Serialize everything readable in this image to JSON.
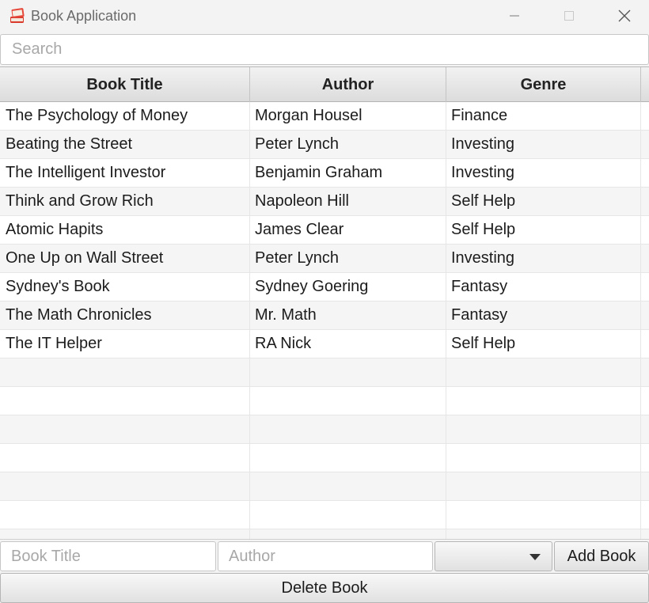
{
  "window": {
    "title": "Book Application",
    "icon": "book-stack-icon"
  },
  "search": {
    "placeholder": "Search",
    "value": ""
  },
  "table": {
    "columns": [
      "Book Title",
      "Author",
      "Genre"
    ],
    "rows": [
      [
        "The Psychology of Money",
        "Morgan Housel",
        "Finance"
      ],
      [
        "Beating the Street",
        "Peter Lynch",
        "Investing"
      ],
      [
        "The Intelligent Investor",
        "Benjamin Graham",
        "Investing"
      ],
      [
        "Think and Grow Rich",
        "Napoleon Hill",
        "Self Help"
      ],
      [
        "Atomic Hapits",
        "James Clear",
        "Self Help"
      ],
      [
        "One Up on Wall Street",
        "Peter Lynch",
        "Investing"
      ],
      [
        "Sydney's Book",
        "Sydney Goering",
        "Fantasy"
      ],
      [
        "The Math Chronicles",
        "Mr. Math",
        "Fantasy"
      ],
      [
        "The IT Helper",
        "RA Nick",
        "Self Help"
      ],
      [
        "",
        "",
        ""
      ],
      [
        "",
        "",
        ""
      ],
      [
        "",
        "",
        ""
      ],
      [
        "",
        "",
        ""
      ],
      [
        "",
        "",
        ""
      ],
      [
        "",
        "",
        ""
      ],
      [
        "",
        "",
        ""
      ]
    ]
  },
  "form": {
    "title_placeholder": "Book Title",
    "author_placeholder": "Author",
    "genre_value": "",
    "add_label": "Add Book",
    "delete_label": "Delete Book"
  }
}
